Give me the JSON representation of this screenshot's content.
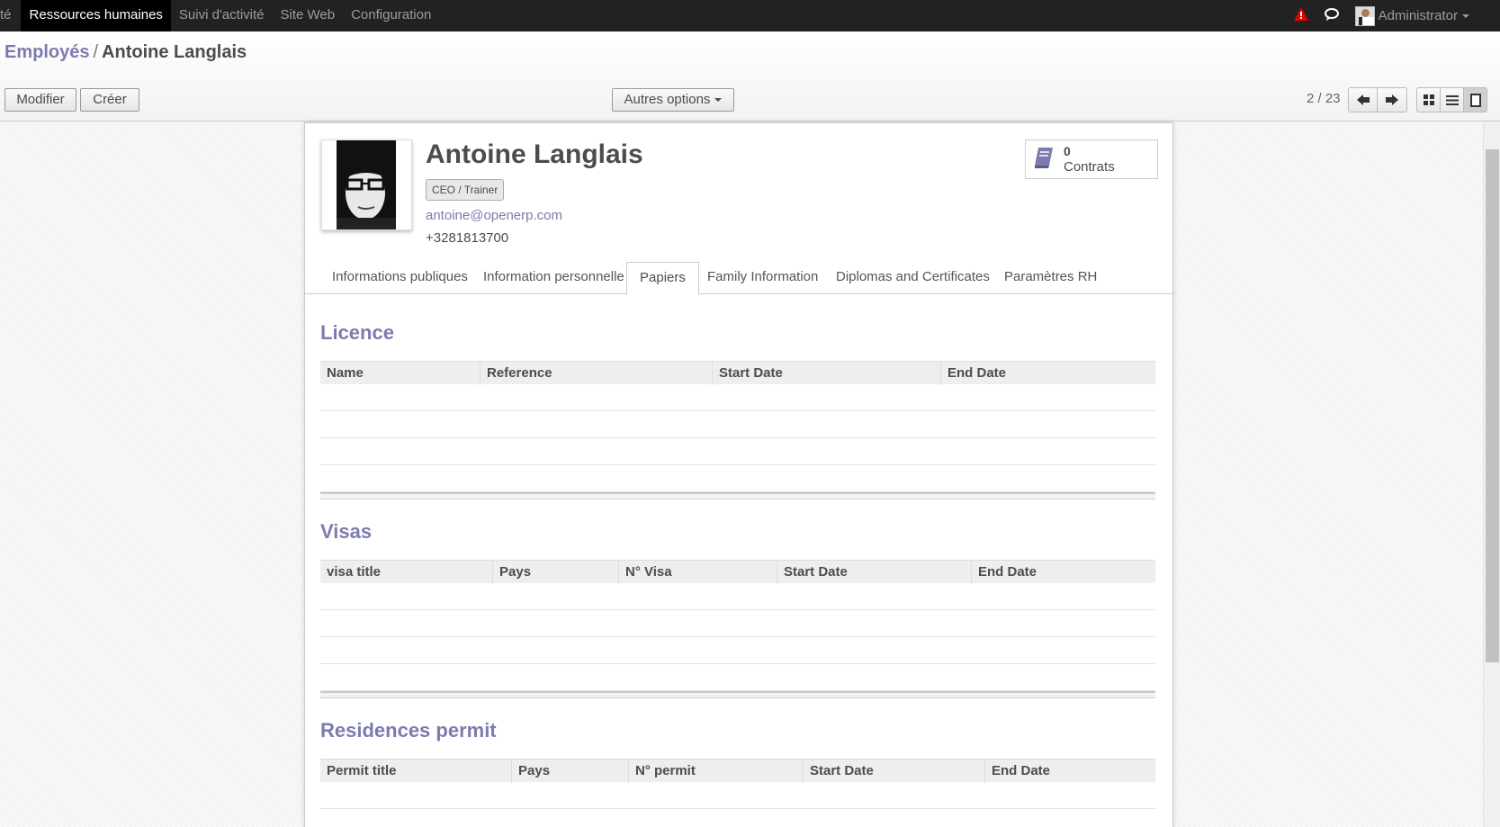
{
  "topbar": {
    "menu": [
      {
        "label": "té"
      },
      {
        "label": "Ressources humaines"
      },
      {
        "label": "Suivi d'activité"
      },
      {
        "label": "Site Web"
      },
      {
        "label": "Configuration"
      }
    ],
    "user": "Administrator",
    "icons": [
      "warning-icon",
      "chat-icon",
      "user-avatar"
    ]
  },
  "breadcrumb": {
    "parent": "Employés",
    "separator": "/",
    "current": "Antoine Langlais"
  },
  "buttons": {
    "edit": "Modifier",
    "create": "Créer",
    "options": "Autres options"
  },
  "pager": {
    "value": "2 / 23"
  },
  "employee": {
    "name": "Antoine Langlais",
    "job_tag": "CEO / Trainer",
    "email": "antoine@openerp.com",
    "phone": "+3281813700",
    "contracts_count": "0",
    "contracts_label": "Contrats"
  },
  "tabs": [
    {
      "label": "Informations publiques"
    },
    {
      "label": "Information personnelle"
    },
    {
      "label": "Papiers"
    },
    {
      "label": "Family Information"
    },
    {
      "label": "Diplomas and Certificates"
    },
    {
      "label": "Paramètres RH"
    }
  ],
  "sections": {
    "licence": {
      "title": "Licence",
      "columns": [
        "Name",
        "Reference",
        "Start Date",
        "End Date"
      ]
    },
    "visas": {
      "title": "Visas",
      "columns": [
        "visa title",
        "Pays",
        "N° Visa",
        "Start Date",
        "End Date"
      ]
    },
    "residences": {
      "title": "Residences permit",
      "columns": [
        "Permit title",
        "Pays",
        "N° permit",
        "Start Date",
        "End Date"
      ]
    }
  },
  "colors": {
    "accent": "#7c7bad",
    "topbar": "#222222",
    "warning": "#e00000"
  }
}
